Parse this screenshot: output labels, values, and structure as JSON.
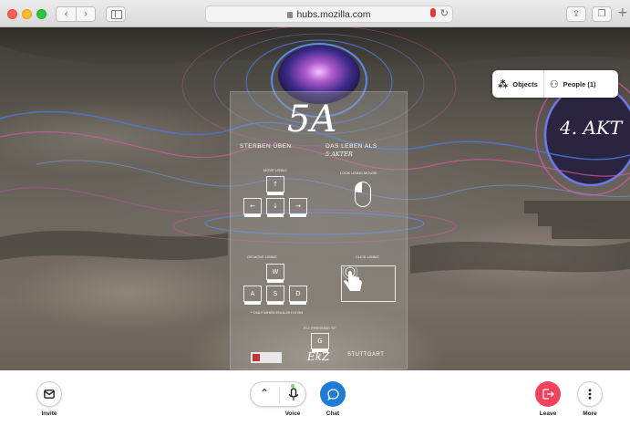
{
  "browser": {
    "url": "hubs.mozilla.com",
    "nav_back_icon": "chevron-left-icon",
    "nav_forward_icon": "chevron-right-icon",
    "new_tab": "+"
  },
  "top_menu": {
    "objects_label": "Objects",
    "people_label": "People (1)"
  },
  "scene": {
    "panel": {
      "title": "5A",
      "subtitle_left": "STERBEN ÜBEN",
      "subtitle_right": "DAS LEBEN ALS",
      "subtitle_right2": "5 AKTER",
      "move_label": "MOVE USING",
      "look_label": "LOOK USING MOUSE",
      "or_move_label": "OR MOVE USING",
      "click_label": "CLICK USING",
      "english_note": "* ONLY WHEN ENGLISH IS ON",
      "fly_label": "FLY PRESSING \"G\"",
      "arrow_keys": [
        "↑",
        "←",
        "↓",
        "→"
      ],
      "wasd_keys": [
        "W",
        "A",
        "S",
        "D"
      ],
      "fly_key": "G",
      "logo_ekz": "EkZ",
      "logo_stuttgart": "STUTTGART"
    },
    "akt_label": "4. AKT"
  },
  "toolbar": {
    "invite_label": "Invite",
    "voice_label": "Voice",
    "chat_label": "Chat",
    "leave_label": "Leave",
    "more_label": "More",
    "chat_color": "#1f7bd6",
    "leave_color": "#f3415e",
    "mic_active_color": "#7ed36a"
  }
}
